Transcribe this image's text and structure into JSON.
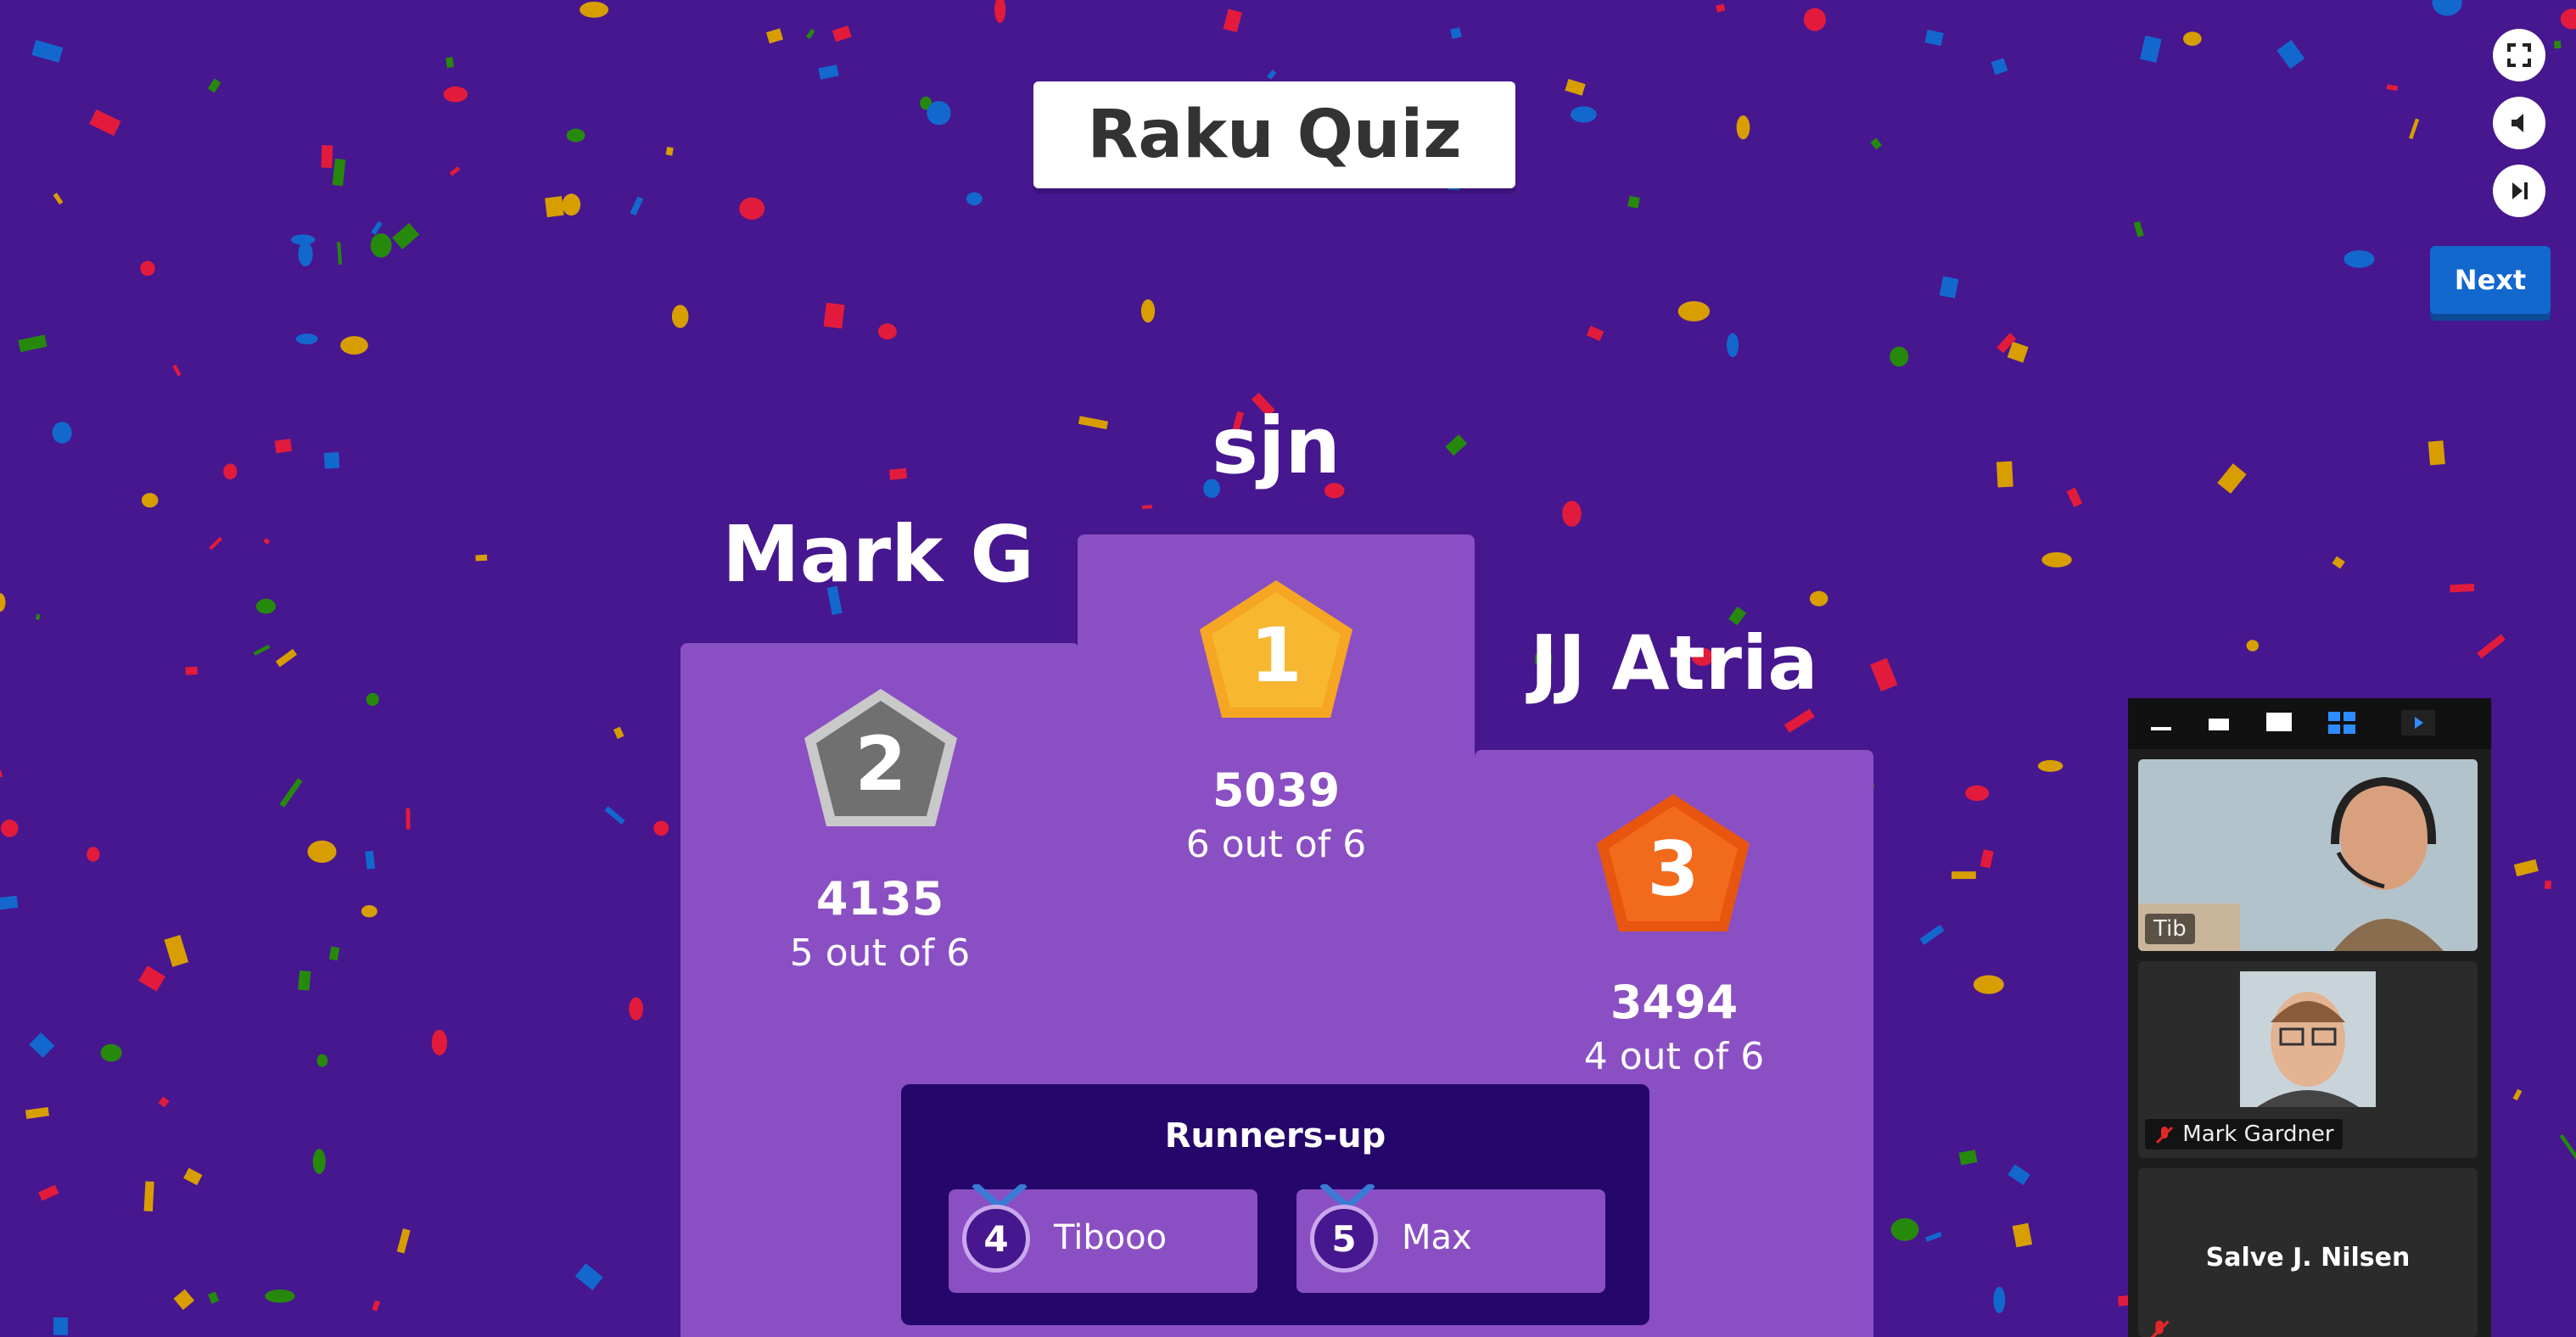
{
  "quiz": {
    "title": "Raku Quiz",
    "next_label": "Next"
  },
  "controls": [
    {
      "icon": "fullscreen-icon"
    },
    {
      "icon": "volume-icon"
    },
    {
      "icon": "skip-icon"
    }
  ],
  "podium": {
    "first": {
      "name": "sjn",
      "rank": "1",
      "score": "5039",
      "answers": "6 out of 6"
    },
    "second": {
      "name": "Mark G",
      "rank": "2",
      "score": "4135",
      "answers": "5 out of 6"
    },
    "third": {
      "name": "JJ Atria",
      "rank": "3",
      "score": "3494",
      "answers": "4 out of 6"
    }
  },
  "runners_up": {
    "title": "Runners-up",
    "players": [
      {
        "rank": "4",
        "name": "Tibooo"
      },
      {
        "rank": "5",
        "name": "Max"
      }
    ]
  },
  "video": {
    "participants": [
      {
        "name": "Tib"
      },
      {
        "name": "Mark Gardner"
      },
      {
        "name": "Salve J. Nilsen"
      }
    ]
  },
  "colors": {
    "background": "#46178f",
    "podium": "#8b4fc4",
    "panel": "#25076b",
    "gold": "#f5a623",
    "silver": "#707070",
    "bronze": "#e8550e",
    "next_button": "#1368ce"
  }
}
